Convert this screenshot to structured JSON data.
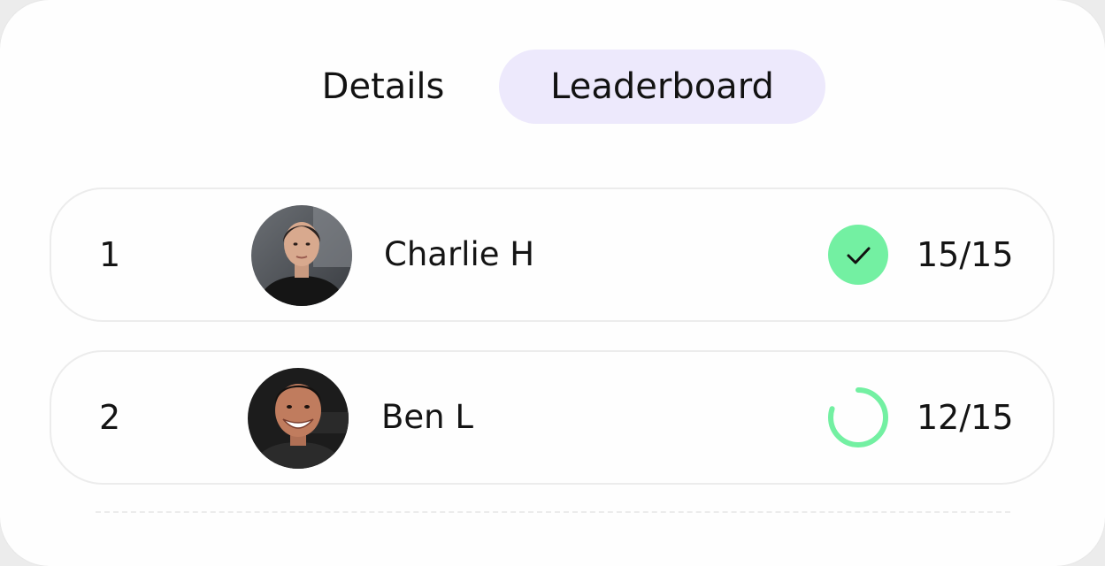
{
  "tabs": {
    "details_label": "Details",
    "leaderboard_label": "Leaderboard",
    "active": "Leaderboard"
  },
  "leaderboard": {
    "rows": [
      {
        "rank": "1",
        "name": "Charlie H",
        "status": "complete",
        "score": "15/15",
        "progress": 1.0,
        "avatar": "avatar-woman"
      },
      {
        "rank": "2",
        "name": "Ben L",
        "status": "in-progress",
        "score": "12/15",
        "progress": 0.8,
        "avatar": "avatar-man"
      }
    ]
  },
  "colors": {
    "active_tab_bg": "#ede9fc",
    "success": "#73f0a2",
    "text": "#141414"
  },
  "icons": {
    "complete": "check-icon",
    "in_progress": "progress-ring-icon"
  }
}
